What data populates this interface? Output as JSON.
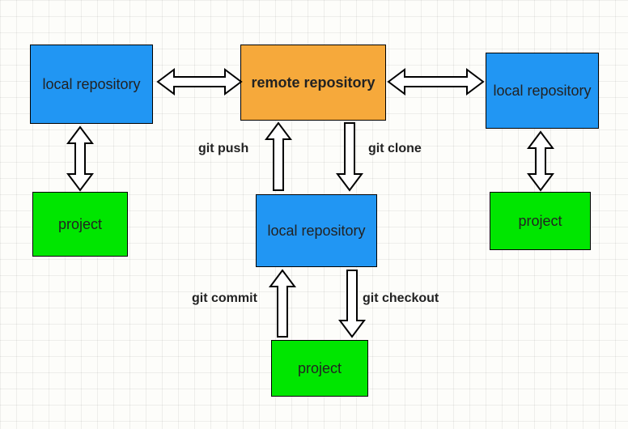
{
  "nodes": {
    "remote": "remote repository",
    "local_left": "local repository",
    "local_right": "local repository",
    "local_center": "local repository",
    "project_left": "project",
    "project_right": "project",
    "project_center": "project"
  },
  "edges": {
    "push": "git push",
    "clone": "git clone",
    "commit": "git commit",
    "checkout": "git checkout"
  },
  "colors": {
    "local": "#2196f3",
    "remote": "#f6a93b",
    "project": "#00e600",
    "grid": "#e5e5e0"
  }
}
